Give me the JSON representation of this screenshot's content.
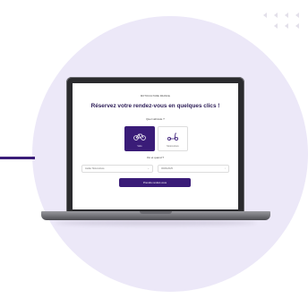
{
  "brand": "MOTOCULTURE FRANCE",
  "headline": "Réservez votre rendez-vous en quelques clics !",
  "question_vehicle": "Quel véhicule ?",
  "options": [
    {
      "label": "Vélo",
      "icon": "bicycle-icon",
      "selected": true
    },
    {
      "label": "Motoculture",
      "icon": "scooter-icon",
      "selected": false
    }
  ],
  "question_where": "Où et quand ?",
  "fields": {
    "location_value": "Atelier Motoculture",
    "date_value": "06/06/2025"
  },
  "cta_label": "Prendre rendez-vous",
  "colors": {
    "brand": "#3a1c78",
    "background_circle": "#ece8f8"
  }
}
